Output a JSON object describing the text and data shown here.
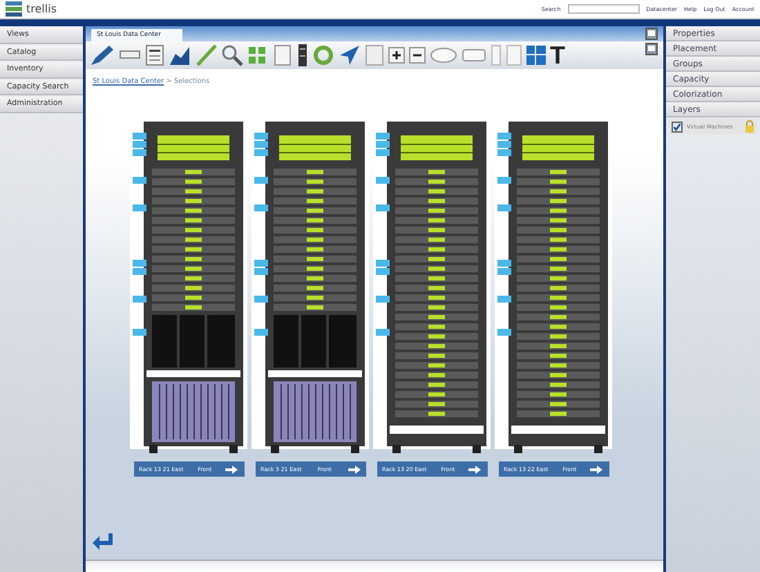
{
  "header": {
    "app_name": "trellis",
    "search_label": "Search",
    "links": [
      "Datacenter",
      "Help",
      "Log Out",
      "Account"
    ]
  },
  "left_nav": {
    "items": [
      {
        "label": "Views",
        "selected": false
      },
      {
        "label": "Catalog",
        "selected": false
      },
      {
        "label": "Inventory",
        "selected": false
      },
      {
        "label": "Capacity Search",
        "selected": false
      },
      {
        "label": "Administration",
        "selected": false
      }
    ]
  },
  "tabs": [
    {
      "label": "St Louis Data Center",
      "selected": true
    }
  ],
  "toolbar": {
    "text_tool": "T"
  },
  "breadcrumb": {
    "link": "St Louis Data Center",
    "rest": " > Selections"
  },
  "racks": [
    {
      "label": "Rack 13 21 East",
      "face": "Front",
      "kind": "blade"
    },
    {
      "label": "Rack 3 21 East",
      "face": "Front",
      "kind": "blade"
    },
    {
      "label": "Rack 13 20 East",
      "face": "Front",
      "kind": "server"
    },
    {
      "label": "Rack 13 22 East",
      "face": "Front",
      "kind": "server"
    }
  ],
  "right_panel": {
    "sections": [
      {
        "label": "Properties"
      },
      {
        "label": "Placement"
      },
      {
        "label": "Groups"
      },
      {
        "label": "Capacity"
      },
      {
        "label": "Colorization"
      },
      {
        "label": "Layers"
      }
    ],
    "layers": [
      {
        "label": "Virtual Machines",
        "checked": true
      }
    ]
  }
}
